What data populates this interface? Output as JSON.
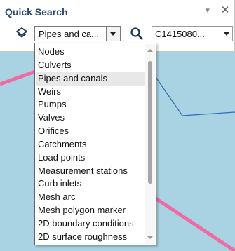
{
  "colors": {
    "map_background": "#a9d2e2",
    "pipe_highlight": "#f06aa4",
    "pipe_line": "#2f6fb3",
    "panel_title": "#2a4a6e"
  },
  "panel": {
    "title": "Quick Search",
    "pin_icon": "pin-down-icon",
    "close_label": "✕"
  },
  "search": {
    "layer_icon": "layers-icon",
    "type_selected": "Pipes and ca...",
    "search_icon": "magnifier-icon",
    "id_selected": "C1415080..."
  },
  "dropdown": {
    "items": [
      "Nodes",
      "Culverts",
      "Pipes and canals",
      "Weirs",
      "Pumps",
      "Valves",
      "Orifices",
      "Catchments",
      "Load points",
      "Measurement stations",
      "Curb inlets",
      "Mesh arc",
      "Mesh polygon marker",
      "2D boundary conditions",
      "2D surface roughness"
    ],
    "selected_index": 2
  }
}
